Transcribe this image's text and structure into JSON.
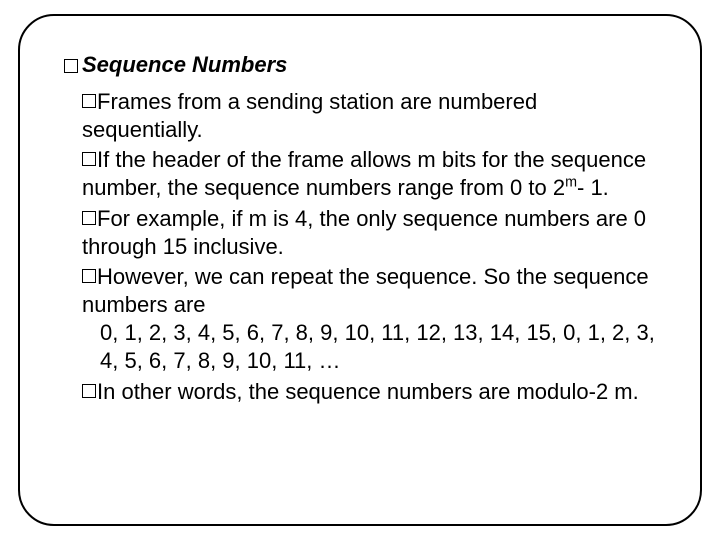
{
  "title": "Sequence Numbers",
  "bullets": {
    "b1": "Frames from a sending station are numbered sequentially.",
    "b2_a": "If the header of the frame allows m bits for the sequence number, the sequence numbers range from 0 to 2",
    "b2_sup": "m",
    "b2_b": "- 1.",
    "b3": "For example, if m is 4, the only sequence numbers are 0 through 15 inclusive.",
    "b4_a": "However, we can repeat the sequence. So the sequence numbers are",
    "b4_b": "0, 1, 2, 3, 4, 5, 6, 7, 8, 9, 10, 11, 12, 13, 14, 15, 0, 1, 2, 3, 4, 5, 6, 7, 8, 9, 10, 11, …",
    "b5": "In other words, the sequence numbers are modulo-2 m."
  }
}
